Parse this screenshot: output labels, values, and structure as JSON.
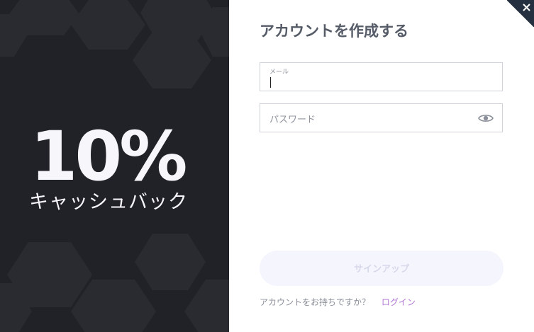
{
  "promo": {
    "percent": "10%",
    "label": "キャッシュバック"
  },
  "form": {
    "title": "アカウントを作成する",
    "email_label": "メール",
    "password_placeholder": "パスワード",
    "signup_button": "サインアップ",
    "login_prompt": "アカウントをお持ちですか？",
    "login_link": "ログイン"
  },
  "icons": {
    "close": "close-icon",
    "eye": "eye-icon"
  },
  "colors": {
    "promo_bg": "#212228",
    "accent_link": "#b176d4",
    "close_corner": "#24303f"
  }
}
